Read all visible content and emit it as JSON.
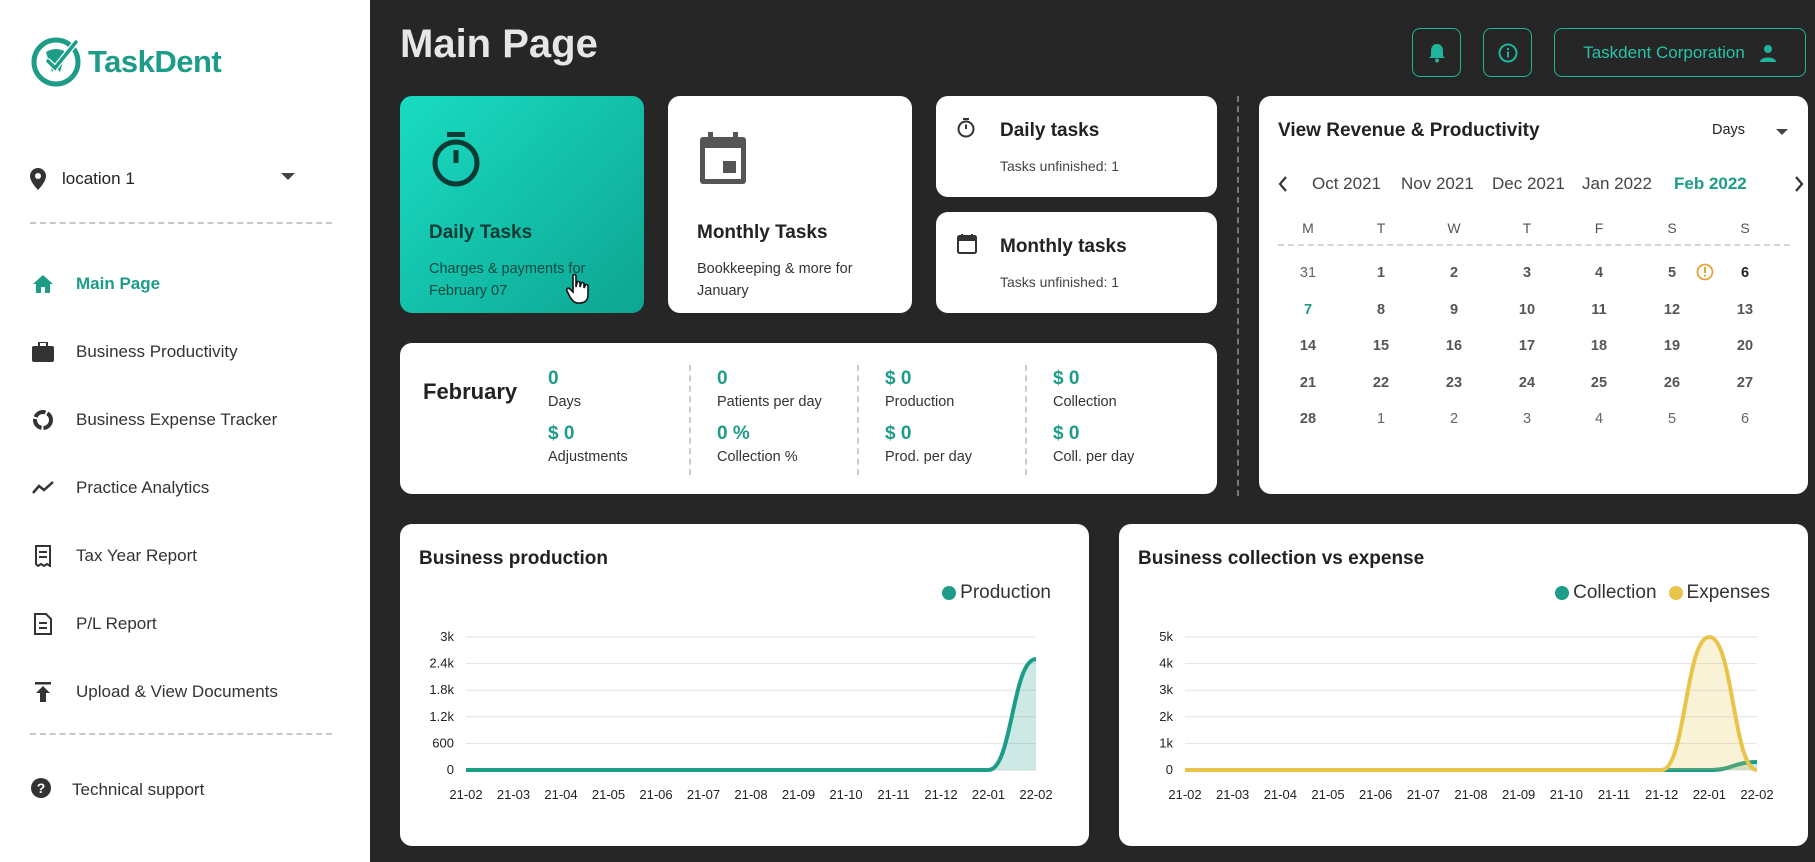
{
  "brand": {
    "name": "TaskDent",
    "color": "#1d9c88"
  },
  "sidebar": {
    "location": "location 1",
    "items": [
      {
        "label": "Main Page",
        "icon": "home-icon"
      },
      {
        "label": "Business Productivity",
        "icon": "briefcase-icon"
      },
      {
        "label": "Business Expense Tracker",
        "icon": "donut-icon"
      },
      {
        "label": "Practice Analytics",
        "icon": "trend-icon"
      },
      {
        "label": "Tax Year Report",
        "icon": "receipt-icon"
      },
      {
        "label": "P/L Report",
        "icon": "document-icon"
      },
      {
        "label": "Upload & View Documents",
        "icon": "upload-icon"
      }
    ],
    "support": "Technical support"
  },
  "header": {
    "title": "Main Page",
    "company": "Taskdent Corporation"
  },
  "cards": {
    "daily_big": {
      "title": "Daily Tasks",
      "subtitle": "Charges & payments for February 07"
    },
    "monthly_big": {
      "title": "Monthly Tasks",
      "subtitle": "Bookkeeping & more for January"
    },
    "daily_small": {
      "title": "Daily tasks",
      "subtitle": "Tasks unfinished: 1"
    },
    "monthly_small": {
      "title": "Monthly tasks",
      "subtitle": "Tasks unfinished: 1"
    }
  },
  "summary": {
    "month": "February",
    "stats": [
      {
        "value": "0",
        "label": "Days"
      },
      {
        "value": "$ 0",
        "label": "Adjustments"
      },
      {
        "value": "0",
        "label": "Patients per day"
      },
      {
        "value": "0 %",
        "label": "Collection %"
      },
      {
        "value": "$ 0",
        "label": "Production"
      },
      {
        "value": "$ 0",
        "label": "Prod. per day"
      },
      {
        "value": "$ 0",
        "label": "Collection"
      },
      {
        "value": "$ 0",
        "label": "Coll. per day"
      }
    ]
  },
  "calendar": {
    "title": "View Revenue & Productivity",
    "mode": "Days",
    "months": [
      "Oct 2021",
      "Nov 2021",
      "Dec 2021",
      "Jan 2022",
      "Feb 2022"
    ],
    "current_month": "Feb 2022",
    "weekdays": [
      "M",
      "T",
      "W",
      "T",
      "F",
      "S",
      "S"
    ],
    "weeks": [
      [
        "31",
        "1",
        "2",
        "3",
        "4",
        "5",
        "6"
      ],
      [
        "7",
        "8",
        "9",
        "10",
        "11",
        "12",
        "13"
      ],
      [
        "14",
        "15",
        "16",
        "17",
        "18",
        "19",
        "20"
      ],
      [
        "21",
        "22",
        "23",
        "24",
        "25",
        "26",
        "27"
      ],
      [
        "28",
        "1",
        "2",
        "3",
        "4",
        "5",
        "6"
      ]
    ],
    "today": "7",
    "warning_day": "6"
  },
  "chart_data": [
    {
      "type": "area",
      "title": "Business production",
      "x": [
        "21-02",
        "21-03",
        "21-04",
        "21-05",
        "21-06",
        "21-07",
        "21-08",
        "21-09",
        "21-10",
        "21-11",
        "21-12",
        "22-01",
        "22-02"
      ],
      "yticks": [
        "0",
        "600",
        "1.2k",
        "1.8k",
        "2.4k",
        "3k"
      ],
      "ylim": [
        0,
        3000
      ],
      "series": [
        {
          "name": "Production",
          "color": "#1d9c88",
          "values": [
            0,
            0,
            0,
            0,
            0,
            0,
            0,
            0,
            0,
            0,
            0,
            0,
            2500
          ]
        }
      ]
    },
    {
      "type": "area",
      "title": "Business collection vs expense",
      "x": [
        "21-02",
        "21-03",
        "21-04",
        "21-05",
        "21-06",
        "21-07",
        "21-08",
        "21-09",
        "21-10",
        "21-11",
        "21-12",
        "22-01",
        "22-02"
      ],
      "yticks": [
        "0",
        "1k",
        "2k",
        "3k",
        "4k",
        "5k"
      ],
      "ylim": [
        0,
        5000
      ],
      "series": [
        {
          "name": "Collection",
          "color": "#1d9c88",
          "values": [
            0,
            0,
            0,
            0,
            0,
            0,
            0,
            0,
            0,
            0,
            0,
            0,
            300
          ]
        },
        {
          "name": "Expenses",
          "color": "#e8c54a",
          "values": [
            0,
            0,
            0,
            0,
            0,
            0,
            0,
            0,
            0,
            0,
            0,
            5000,
            0
          ]
        }
      ]
    }
  ]
}
